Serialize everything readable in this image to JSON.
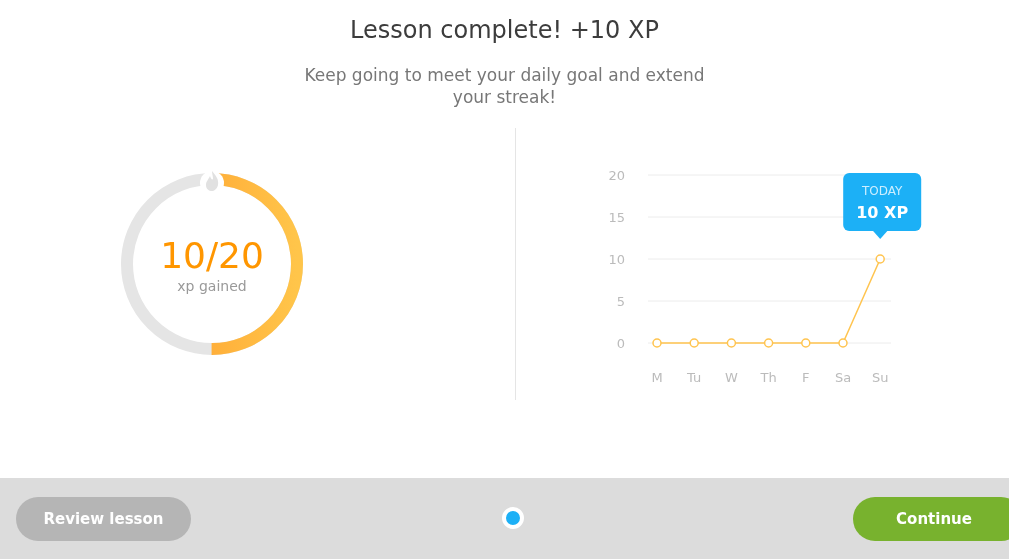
{
  "title": {
    "text": "Lesson complete!",
    "bonus": "+10 XP"
  },
  "subtitle": "Keep going to meet your daily goal and extend your streak!",
  "goal": {
    "value": "10/20",
    "caption": "xp gained",
    "level": 0.5
  },
  "chart": {
    "tooltip": {
      "label": "TODAY",
      "value": "10 XP"
    },
    "chart_data": {
      "type": "line",
      "categories": [
        "M",
        "Tu",
        "W",
        "Th",
        "F",
        "Sa",
        "Su"
      ],
      "series": [
        {
          "color": "#ffc44f",
          "marker": true,
          "values": [
            0,
            0,
            0,
            0,
            0,
            0,
            10
          ]
        }
      ],
      "ylim": [
        0,
        20
      ],
      "yticks": [
        0,
        5,
        10,
        15,
        20
      ],
      "grid": true
    }
  },
  "footer": {
    "buttons": [
      {
        "label": "Review lesson",
        "kind": "secondary"
      },
      {
        "label": "Continue",
        "kind": "primary"
      }
    ],
    "progress_dots": [
      {
        "selected": true
      }
    ]
  }
}
